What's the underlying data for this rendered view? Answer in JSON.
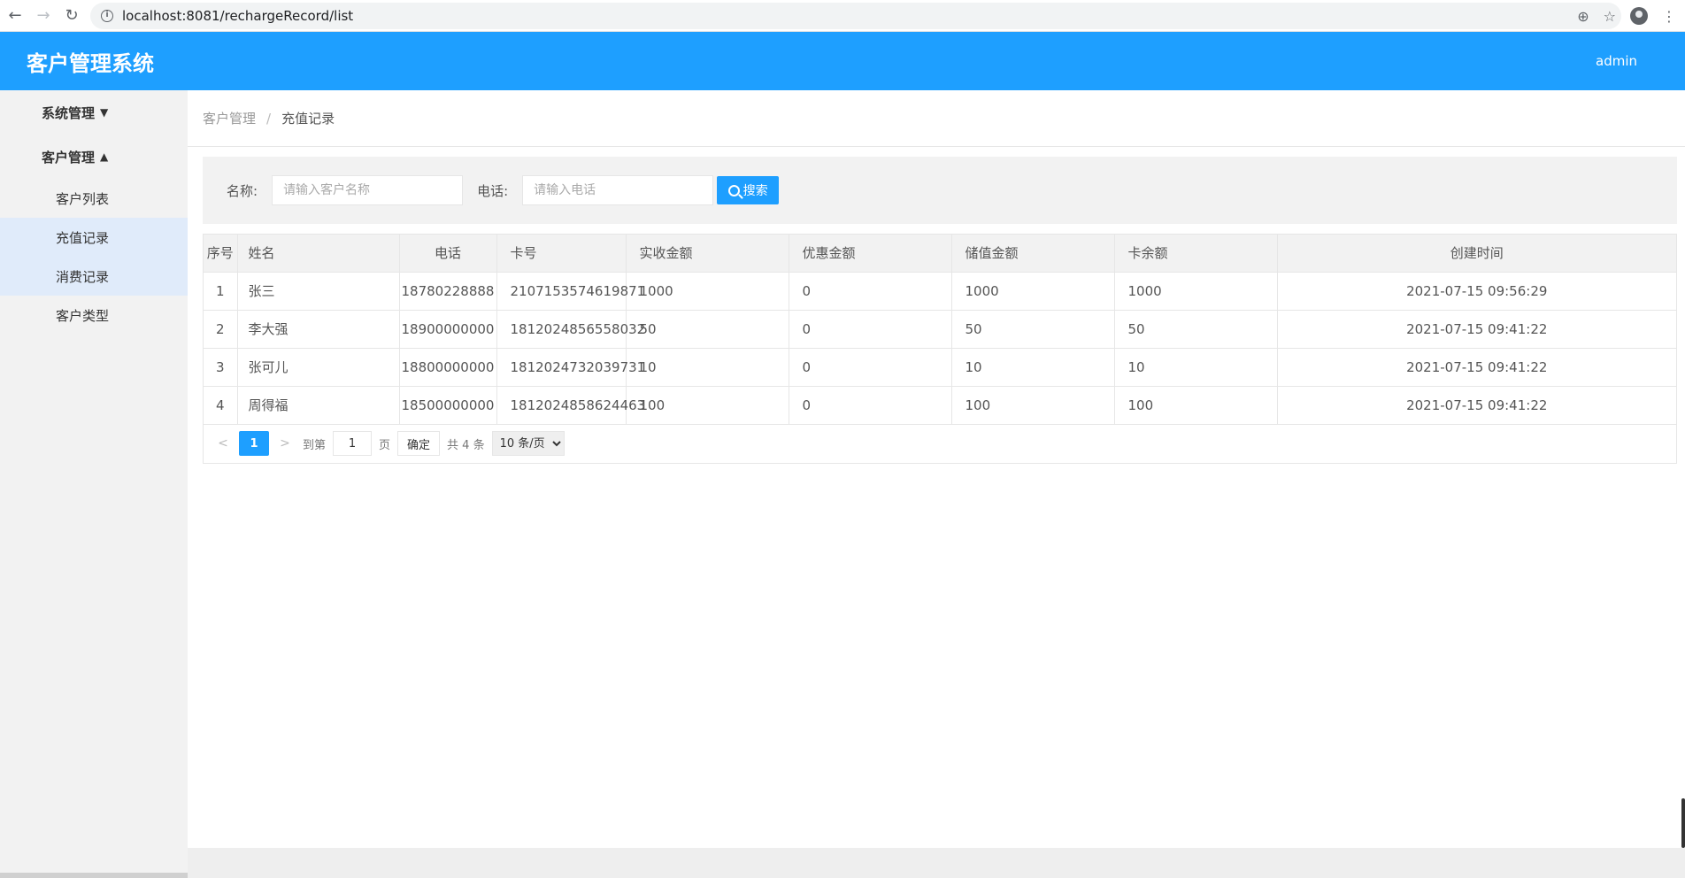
{
  "browser": {
    "url": "localhost:8081/rechargeRecord/list"
  },
  "header": {
    "title": "客户管理系统",
    "user": "admin"
  },
  "sidebar": {
    "groups": [
      {
        "label": "系统管理",
        "expanded": false
      },
      {
        "label": "客户管理",
        "expanded": true
      }
    ],
    "items": [
      {
        "label": "客户列表"
      },
      {
        "label": "充值记录"
      },
      {
        "label": "消费记录"
      },
      {
        "label": "客户类型"
      }
    ]
  },
  "breadcrumb": {
    "parent": "客户管理",
    "separator": "/",
    "current": "充值记录"
  },
  "search": {
    "name_label": "名称:",
    "name_placeholder": "请输入客户名称",
    "phone_label": "电话:",
    "phone_placeholder": "请输入电话",
    "button": "搜索"
  },
  "table": {
    "headers": [
      "序号",
      "姓名",
      "电话",
      "卡号",
      "实收金额",
      "优惠金额",
      "储值金额",
      "卡余额",
      "创建时间"
    ],
    "rows": [
      [
        "1",
        "张三",
        "18780228888",
        "2107153574619871",
        "1000",
        "0",
        "1000",
        "1000",
        "2021-07-15 09:56:29"
      ],
      [
        "2",
        "李大强",
        "18900000000",
        "1812024856558032",
        "50",
        "0",
        "50",
        "50",
        "2021-07-15 09:41:22"
      ],
      [
        "3",
        "张可儿",
        "18800000000",
        "1812024732039731",
        "10",
        "0",
        "10",
        "10",
        "2021-07-15 09:41:22"
      ],
      [
        "4",
        "周得福",
        "18500000000",
        "1812024858624463",
        "100",
        "0",
        "100",
        "100",
        "2021-07-15 09:41:22"
      ]
    ]
  },
  "pager": {
    "prev": "<",
    "current": "1",
    "next": ">",
    "goto_label": "到第",
    "goto_value": "1",
    "page_unit": "页",
    "confirm": "确定",
    "total": "共 4 条",
    "page_size": "10 条/页"
  },
  "colors": {
    "primary": "#1e9fff",
    "sidebar_bg": "#f2f2f2",
    "active_item_bg": "#e0ebfa"
  }
}
